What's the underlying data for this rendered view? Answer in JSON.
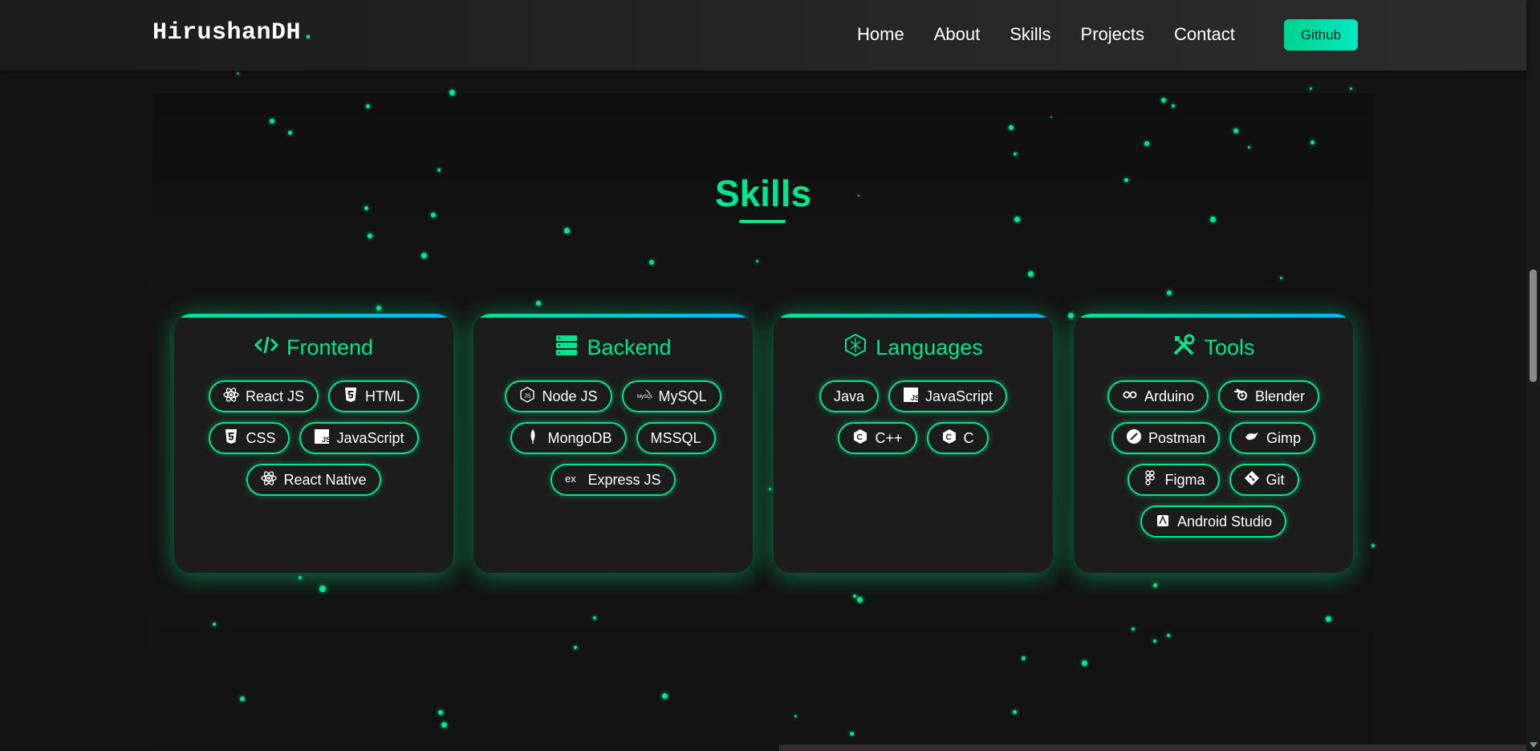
{
  "brand": {
    "name": "HirushanDH",
    "dot": ".",
    "accent": "#00e58f"
  },
  "nav": {
    "links": [
      "Home",
      "About",
      "Skills",
      "Projects",
      "Contact"
    ],
    "github_label": "Github"
  },
  "skills": {
    "title": "Skills",
    "categories": [
      {
        "title": "Frontend",
        "icon": "code-icon",
        "items": [
          {
            "label": "React JS",
            "icon": "react-icon"
          },
          {
            "label": "HTML",
            "icon": "html5-icon"
          },
          {
            "label": "CSS",
            "icon": "css3-icon"
          },
          {
            "label": "JavaScript",
            "icon": "js-icon"
          },
          {
            "label": "React Native",
            "icon": "react-icon"
          }
        ]
      },
      {
        "title": "Backend",
        "icon": "server-icon",
        "items": [
          {
            "label": "Node JS",
            "icon": "nodejs-icon"
          },
          {
            "label": "MySQL",
            "icon": "mysql-icon"
          },
          {
            "label": "MongoDB",
            "icon": "mongodb-icon"
          },
          {
            "label": "MSSQL",
            "icon": ""
          },
          {
            "label": "Express JS",
            "icon": "express-icon"
          }
        ]
      },
      {
        "title": "Languages",
        "icon": "hexagon-icon",
        "items": [
          {
            "label": "Java",
            "icon": ""
          },
          {
            "label": "JavaScript",
            "icon": "js-icon"
          },
          {
            "label": "C++",
            "icon": "cpp-icon"
          },
          {
            "label": "C",
            "icon": "c-icon"
          }
        ]
      },
      {
        "title": "Tools",
        "icon": "tools-icon",
        "items": [
          {
            "label": "Arduino",
            "icon": "infinity-icon"
          },
          {
            "label": "Blender",
            "icon": "blender-icon"
          },
          {
            "label": "Postman",
            "icon": "postman-icon"
          },
          {
            "label": "Gimp",
            "icon": "gimp-icon"
          },
          {
            "label": "Figma",
            "icon": "figma-icon"
          },
          {
            "label": "Git",
            "icon": "git-icon"
          },
          {
            "label": "Android Studio",
            "icon": "android-studio-icon"
          }
        ]
      }
    ]
  }
}
